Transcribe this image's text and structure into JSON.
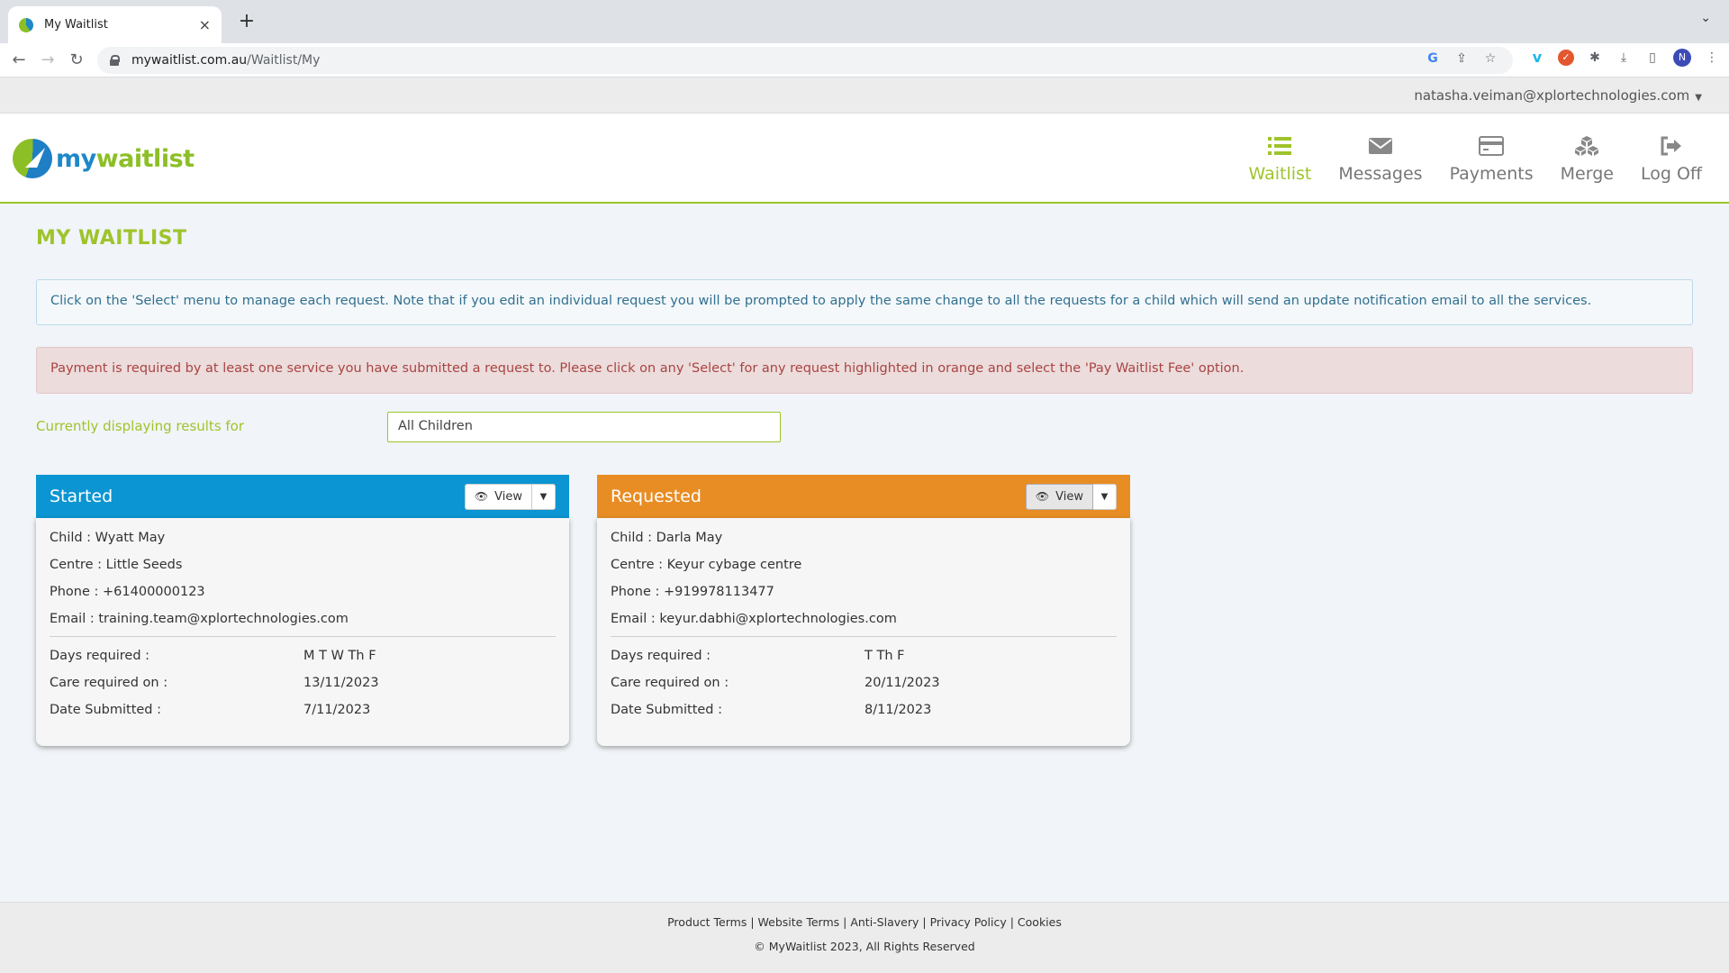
{
  "browser": {
    "tab_title": "My Waitlist",
    "tab_close": "×",
    "new_tab": "+",
    "url_domain": "mywaitlist.com.au",
    "url_path": "/Waitlist/My",
    "profile_initial": "N"
  },
  "userbar": {
    "email": "natasha.veiman@xplortechnologies.com"
  },
  "logo": {
    "part1": "my",
    "part2": "waitlist"
  },
  "nav": [
    {
      "label": "Waitlist",
      "icon": "list-icon",
      "active": true
    },
    {
      "label": "Messages",
      "icon": "envelope-icon"
    },
    {
      "label": "Payments",
      "icon": "credit-card-icon"
    },
    {
      "label": "Merge",
      "icon": "cubes-icon"
    },
    {
      "label": "Log Off",
      "icon": "sign-out-icon"
    }
  ],
  "page": {
    "title": "MY WAITLIST",
    "info_alert": "Click on the 'Select' menu to manage each request. Note that if you edit an individual request you will be prompted to apply the same change to all the requests for a child which will send an update notification email to all the services.",
    "danger_alert": "Payment is required by at least one service you have submitted a request to. Please click on any 'Select' for any request highlighted in orange and select the 'Pay Waitlist Fee' option.",
    "filter_label": "Currently displaying results for",
    "filter_value": "All Children"
  },
  "cards": [
    {
      "status": "Started",
      "color": "#0b95d2",
      "view_label": "View",
      "child": "Child : Wyatt May",
      "centre": "Centre : Little Seeds",
      "phone": "Phone : +61400000123",
      "email": "Email : training.team@xplortechnologies.com",
      "days_label": "Days required :",
      "days_value": "M T W Th F",
      "care_label": "Care required on :",
      "care_value": "13/11/2023",
      "submitted_label": "Date Submitted :",
      "submitted_value": "7/11/2023"
    },
    {
      "status": "Requested",
      "color": "#e88d24",
      "view_label": "View",
      "child": "Child : Darla May",
      "centre": "Centre : Keyur cybage centre",
      "phone": "Phone : +919978113477",
      "email": "Email : keyur.dabhi@xplortechnologies.com",
      "days_label": "Days required :",
      "days_value": "T Th F",
      "care_label": "Care required on :",
      "care_value": "20/11/2023",
      "submitted_label": "Date Submitted :",
      "submitted_value": "8/11/2023"
    }
  ],
  "footer": {
    "links": [
      "Product Terms",
      "Website Terms",
      "Anti-Slavery",
      "Privacy Policy",
      "Cookies"
    ],
    "separator": " | ",
    "copyright": "© MyWaitlist 2023, All Rights Reserved"
  }
}
